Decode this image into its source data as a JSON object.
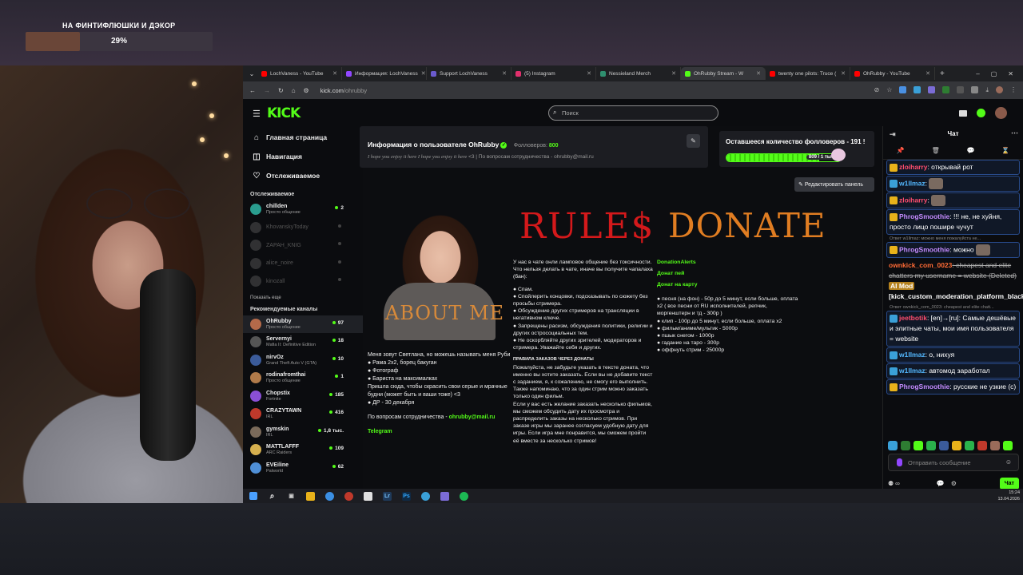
{
  "overlay": {
    "goal_title": "НА ФИНТИФЛЮШКИ И ДЭКОР",
    "goal_percent_text": "29%",
    "goal_percent": 29
  },
  "browser": {
    "tabs": [
      {
        "label": "LochVaness - YouTube",
        "color": "#ff0000"
      },
      {
        "label": "Информация: LochVaness",
        "color": "#9147ff"
      },
      {
        "label": "Support LochVaness",
        "color": "#6a5acd"
      },
      {
        "label": "(5) Instagram",
        "color": "#e1306c"
      },
      {
        "label": "Nessieland Merch",
        "color": "#2f8f6f"
      },
      {
        "label": "OhRubby Stream - W",
        "color": "#53fc18"
      },
      {
        "label": "twenty one pilots: Truce (",
        "color": "#ff0000"
      },
      {
        "label": "OhRubby - YouTube",
        "color": "#ff0000"
      }
    ],
    "url_host": "kick.com",
    "url_path": "/ohrubby"
  },
  "kick": {
    "logo": "KICK",
    "search_placeholder": "Поиск"
  },
  "sidebar": {
    "nav": [
      {
        "icon": "⌂",
        "label": "Главная страница"
      },
      {
        "icon": "◫",
        "label": "Навигация"
      },
      {
        "icon": "♡",
        "label": "Отслеживаемое"
      }
    ],
    "followed_title": "Отслеживаемое",
    "followed": [
      {
        "name": "chillden",
        "sub": "Просто общение",
        "viewers": "2",
        "online": true,
        "color": "#2a9d8f"
      },
      {
        "name": "KhovanskyToday",
        "sub": "",
        "viewers": "",
        "online": false,
        "color": "#777"
      },
      {
        "name": "ZAPAH_KNIG",
        "sub": "",
        "viewers": "",
        "online": false,
        "color": "#777"
      },
      {
        "name": "alice_noire",
        "sub": "",
        "viewers": "",
        "online": false,
        "color": "#777"
      },
      {
        "name": "kinozall",
        "sub": "",
        "viewers": "",
        "online": false,
        "color": "#777"
      }
    ],
    "show_more": "Показать еще",
    "recommended_title": "Рекомендуемые каналы",
    "recommended": [
      {
        "name": "OhRubby",
        "sub": "Просто общение",
        "viewers": "97",
        "color": "#b46a4a"
      },
      {
        "name": "Servernyi",
        "sub": "Mafia II: Definitive Edition",
        "viewers": "18",
        "color": "#555"
      },
      {
        "name": "nirvOz",
        "sub": "Grand Theft Auto V (GTA)",
        "viewers": "10",
        "color": "#3b5b9a"
      },
      {
        "name": "rodinafromthai",
        "sub": "Просто общение",
        "viewers": "1",
        "color": "#b07a4a"
      },
      {
        "name": "Chopstix",
        "sub": "Fortnite",
        "viewers": "185",
        "color": "#8a4fd6"
      },
      {
        "name": "CRAZYTAWN",
        "sub": "IRL",
        "viewers": "416",
        "color": "#c0392b"
      },
      {
        "name": "gymskin",
        "sub": "IRL",
        "viewers": "1,8 тыс.",
        "color": "#7a6a5a"
      },
      {
        "name": "MATTLAFFF",
        "sub": "ARC Raiders",
        "viewers": "109",
        "color": "#d6b04f"
      },
      {
        "name": "EVEiline",
        "sub": "Palworld",
        "viewers": "62",
        "color": "#4f8fd6"
      }
    ]
  },
  "info": {
    "title": "Информация о пользователе OhRubby",
    "followers_label": "Фолловеров:",
    "followers_value": "800",
    "sub_italic": "I hope you enjoy it here I hope you enjoy it here",
    "sub_rest": "<3 | По вопросам сотрудничества - ohrubby@mail.ru"
  },
  "goal": {
    "title": "Оставшееся количество фолловеров - 191 !",
    "label": "809 / 1 тыс.",
    "fraction": 0.809
  },
  "edit_panel": "Редактировать панель",
  "about": {
    "art_text": "ABOUT ME",
    "lines": [
      "Меня зовут Светлана, но можешь называть меня Руби",
      "● Рама 2х2, борец бакуган",
      "● Фотограф",
      "● Бариста на максималках",
      "Пришла сюда, чтобы скрасить свои серые и мрачные будни (может быть и ваши тоже) <3",
      "● ДР - 30 декабря"
    ],
    "contact_prefix": "По вопросам сотрудничества - ",
    "contact_email": "ohrubby@mail.ru",
    "telegram": "Telegram"
  },
  "rules": {
    "title": "RULE$",
    "intro": "У нас в чате онли ламповое общение без токсичности.",
    "forbidden": "Что нельзя делать в чате, иначе вы получите чапалаха (бан):",
    "items": [
      "● Спам.",
      "● Спойлерить концовки, подсказывать по сюжету без просьбы стримера.",
      "● Обсуждение других стримеров на трансляции в негативном ключе.",
      "● Запрещены расизм, обсуждения политики, религии и других остросоциальных тем.",
      "● Не оскорбляйте других зрителей, модераторов и стримера. Уважайте себя и других."
    ],
    "orders_title": "ПРАВИЛА ЗАКАЗОВ ЧЕРЕЗ ДОНАТЫ",
    "orders": [
      "Пожалуйста, не забудьте указать в тексте доната, что именно вы хотите заказать. Если вы не добавите текст с заданием, я, к сожалению, не смогу его выполнить. Также напоминаю, что за один стрим можно заказать только один фильм.",
      "Если у вас есть желание заказать несколько фильмов, мы сможем обсудить дату их просмотра и распределить заказы на несколько стримов. При заказе игры мы заранее согласуем удобную дату для игры. Если игра мне понравится, мы сможем пройти её вместе за несколько стримов!"
    ]
  },
  "donate": {
    "title": "DONATE",
    "links": [
      "DonationAlerts",
      "Донат пей",
      "Донат на карту"
    ],
    "items": [
      "● песня (на фон) - 50р до 5 минут, если больше, оплата x2 ( все песни от RU исполнителей, репчик, моргенштерн и тд - 300р )",
      "● клип - 100р до 5 минут, если больше, оплата x2",
      "● фильм/аниме/мультик - 5000р",
      "● пшык снегом - 1000р",
      "● гадание на таро - 300р",
      "● оффнуть стрим - 25000р"
    ]
  },
  "chat": {
    "title": "Чат",
    "messages": [
      {
        "user": "zloiharry",
        "color": "#ff4d6d",
        "badge": "#e8b21a",
        "text": ": открывай рот",
        "hl": true
      },
      {
        "user": "w1llmaz",
        "color": "#53b8ff",
        "badge": "#3aa0d8",
        "text": ":",
        "hl": true,
        "emote": true
      },
      {
        "user": "zloiharry",
        "color": "#ff4d6d",
        "badge": "#e8b21a",
        "text": ":",
        "hl": true,
        "emote": true
      },
      {
        "user": "PhrogSmoothie",
        "color": "#c58bff",
        "badge": "#e8b21a",
        "text": ": !!! не, не хуйня, просто лицо пошире чучут",
        "hl": true
      },
      {
        "reply": "Ответ w1llmaz: можно меня пожалуйста не..."
      },
      {
        "user": "PhrogSmoothie",
        "color": "#c58bff",
        "badge": "#e8b21a",
        "text": ": можно",
        "hl": true,
        "emote": true
      },
      {
        "user": "ownkick_com_0023",
        "color": "#ff6b35",
        "badge": "",
        "text": ": cheapest and elite chatters my username = website (Deleted)",
        "mod": "AI Mod",
        "tail": "[kick_custom_moderation_platform_blacklist]",
        "hl": false
      },
      {
        "reply": "Ответ ownkick_com_0023: cheapest and elite chatt..."
      },
      {
        "user": "jeetbotik",
        "color": "#ff4d6d",
        "badge": "#3aa0d8",
        "text": ": [en]→[ru]: Самые дешёвые и элитные чаты, мои имя пользователя = website",
        "hl": true
      },
      {
        "user": "w1llmaz",
        "color": "#53b8ff",
        "badge": "#3aa0d8",
        "text": ": о, нихуя",
        "hl": true
      },
      {
        "user": "w1llmaz",
        "color": "#53b8ff",
        "badge": "#3aa0d8",
        "text": ": автомод заработал",
        "hl": true
      },
      {
        "user": "PhrogSmoothie",
        "color": "#c58bff",
        "badge": "#e8b21a",
        "text": ": русские не узкие (c)",
        "hl": true
      }
    ],
    "input_placeholder": "Отправить сообщение",
    "points": "∞",
    "send": "Чат"
  },
  "taskbar": {
    "time": "15:24",
    "date": "13.04.2026"
  }
}
